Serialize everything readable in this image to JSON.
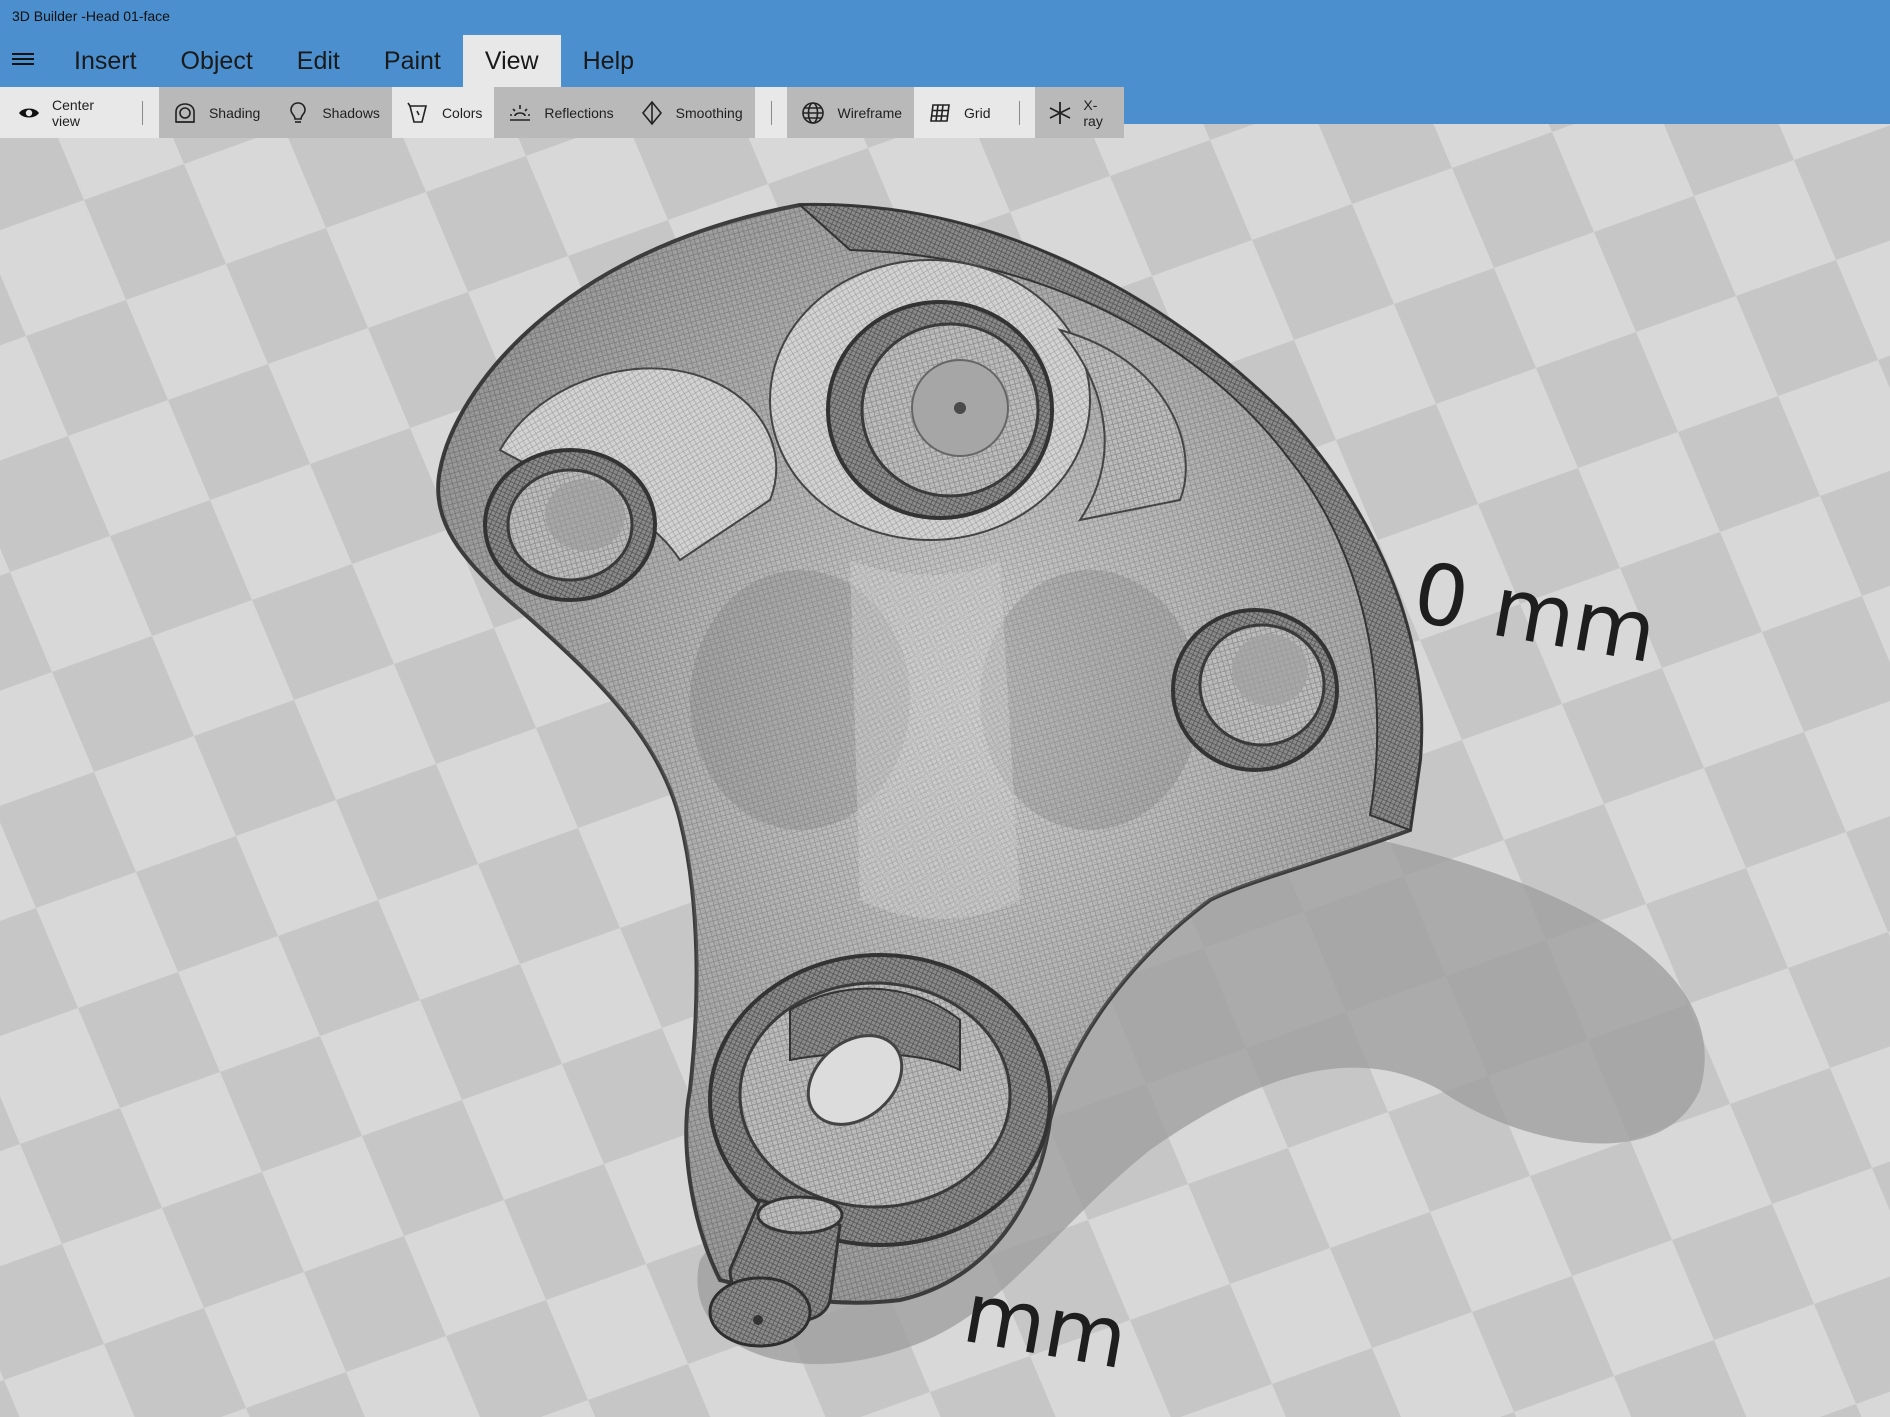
{
  "window": {
    "title": "3D Builder -Head 01-face"
  },
  "menu": {
    "tabs": [
      {
        "label": "Insert",
        "active": false
      },
      {
        "label": "Object",
        "active": false
      },
      {
        "label": "Edit",
        "active": false
      },
      {
        "label": "Paint",
        "active": false
      },
      {
        "label": "View",
        "active": true
      },
      {
        "label": "Help",
        "active": false
      }
    ]
  },
  "toolbar": {
    "center_view": {
      "label": "Center view",
      "icon": "eye-icon",
      "on": false
    },
    "shading": {
      "label": "Shading",
      "icon": "shading-icon",
      "on": true
    },
    "shadows": {
      "label": "Shadows",
      "icon": "lightbulb-icon",
      "on": true
    },
    "colors": {
      "label": "Colors",
      "icon": "paint-bucket-icon",
      "on": false
    },
    "reflections": {
      "label": "Reflections",
      "icon": "reflections-icon",
      "on": true
    },
    "smoothing": {
      "label": "Smoothing",
      "icon": "smoothing-icon",
      "on": true
    },
    "wireframe": {
      "label": "Wireframe",
      "icon": "globe-icon",
      "on": true
    },
    "grid": {
      "label": "Grid",
      "icon": "grid-icon",
      "on": false
    },
    "xray": {
      "label": "X-ray",
      "icon": "asterisk-icon",
      "on": true
    }
  },
  "viewport": {
    "dimension_labels": [
      "0 mm",
      "mm"
    ]
  },
  "colors": {
    "header": "#4b8fcf",
    "toolbar": "#e8e8e8",
    "toolbar_active": "#b9b9b9"
  }
}
